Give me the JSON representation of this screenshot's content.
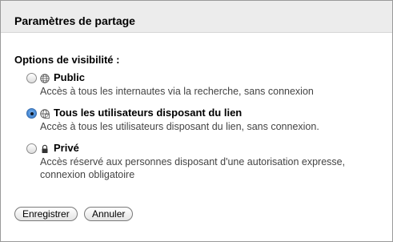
{
  "dialog": {
    "title": "Paramètres de partage",
    "section_label": "Options de visibilité :"
  },
  "options": [
    {
      "title": "Public",
      "description": "Accès à tous les internautes via la recherche, sans connexion",
      "icon": "globe-icon",
      "checked": false
    },
    {
      "title": "Tous les utilisateurs disposant du lien",
      "description": "Accès à tous les utilisateurs disposant du lien, sans connexion.",
      "icon": "link-globe-icon",
      "checked": true
    },
    {
      "title": "Privé",
      "description": "Accès réservé aux personnes disposant d'une autorisation expresse, connexion obligatoire",
      "icon": "lock-icon",
      "checked": false
    }
  ],
  "buttons": {
    "save": "Enregistrer",
    "cancel": "Annuler"
  },
  "colors": {
    "header_bg": "#ececec",
    "radio_selected": "#4d8fd8"
  }
}
